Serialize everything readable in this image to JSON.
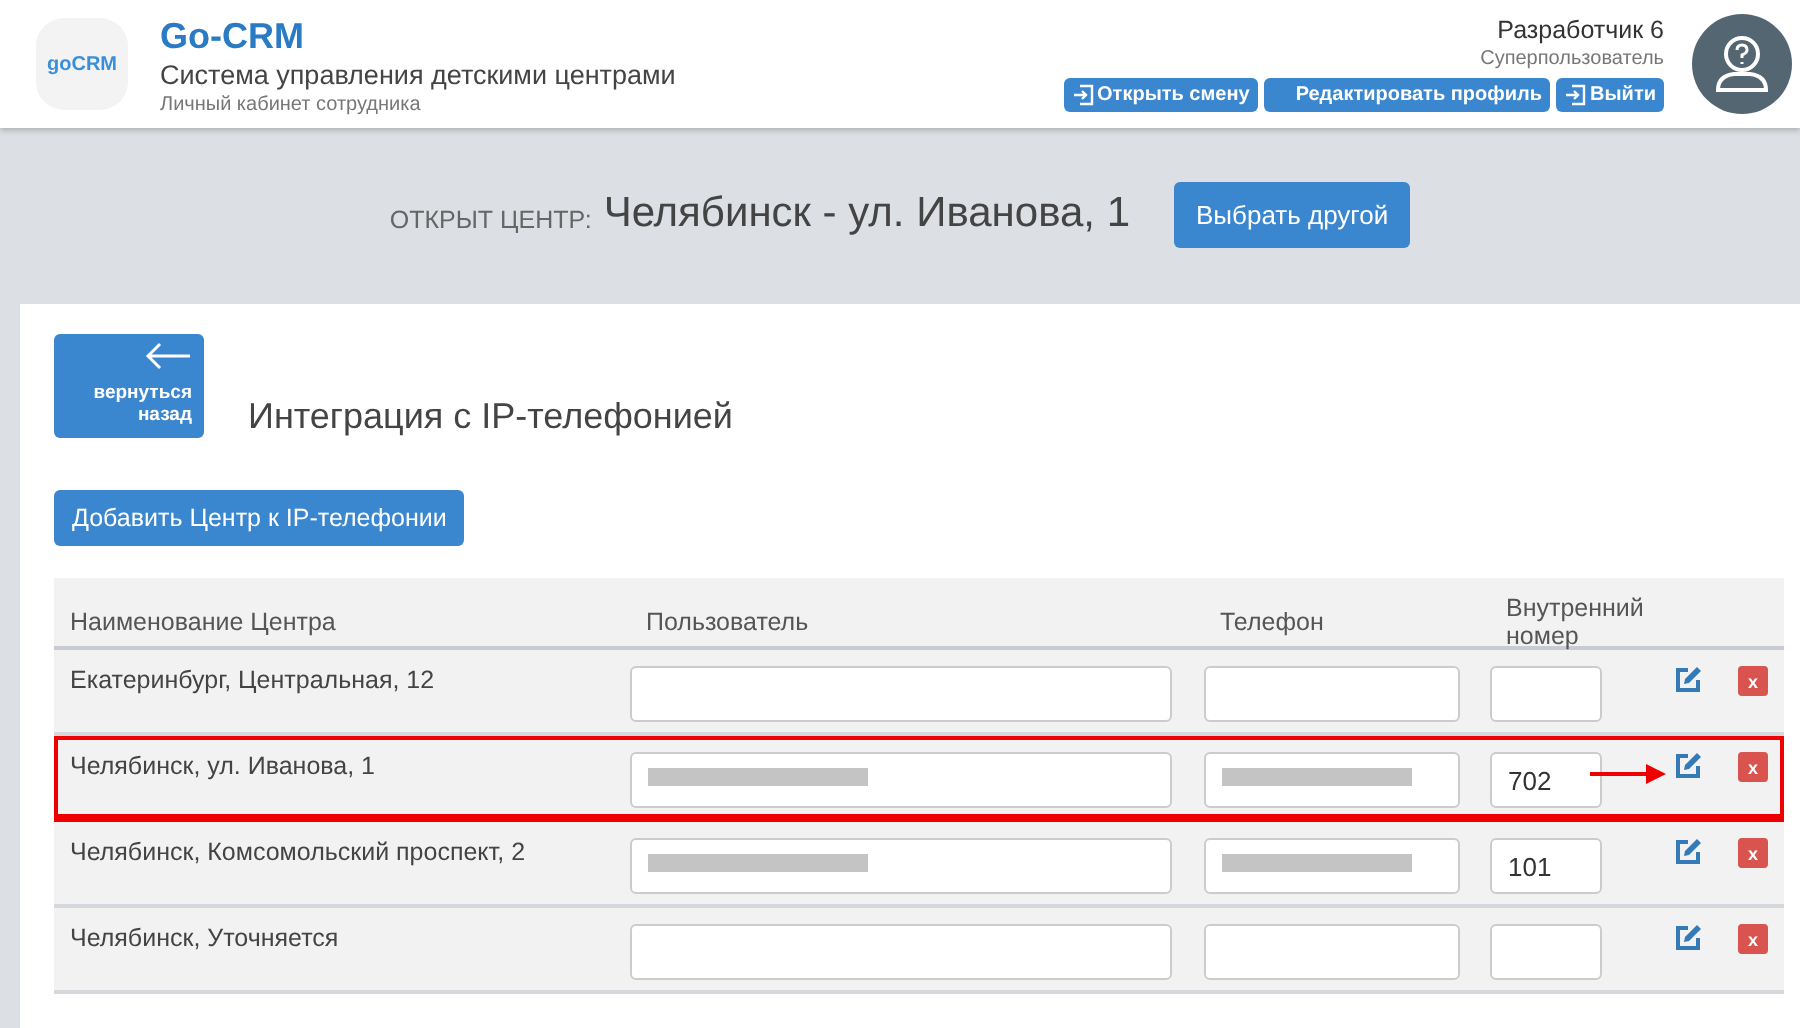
{
  "header": {
    "logo": "goCRM",
    "title": "Go-CRM",
    "subtitle": "Система управления детскими центрами",
    "caption": "Личный кабинет сотрудника",
    "user": {
      "name": "Разработчик 6",
      "role": "Суперпользователь"
    },
    "buttons": [
      {
        "label": "Открыть смену",
        "icon": true
      },
      {
        "label": "Редактировать профиль",
        "icon": false
      },
      {
        "label": "Выйти",
        "icon": true
      }
    ]
  },
  "center_bar": {
    "label": "ОТКРЫТ ЦЕНТР:",
    "name": "Челябинск - ул. Иванова, 1",
    "button": "Выбрать другой"
  },
  "back_button": "вернуться назад",
  "page_title": "Интеграция с IP-телефонией",
  "add_button": "Добавить Центр к IP-телефонии",
  "table": {
    "columns": [
      "Наименование Центра",
      "Пользователь",
      "Телефон",
      "Внутренний номер"
    ],
    "rows": [
      {
        "name": "Екатеринбург, Центральная, 12",
        "user_redacted": false,
        "phone_redacted": false,
        "ext": "",
        "highlighted": false,
        "delete_label": "x"
      },
      {
        "name": "Челябинск, ул. Иванова, 1",
        "user_redacted": true,
        "phone_redacted": true,
        "ext": "702",
        "highlighted": true,
        "delete_label": "x"
      },
      {
        "name": "Челябинск, Комсомольский проспект, 2",
        "user_redacted": true,
        "phone_redacted": true,
        "ext": "101",
        "highlighted": false,
        "delete_label": "x"
      },
      {
        "name": "Челябинск, Уточняется",
        "user_redacted": false,
        "phone_redacted": false,
        "ext": "",
        "highlighted": false,
        "delete_label": "x"
      }
    ]
  }
}
